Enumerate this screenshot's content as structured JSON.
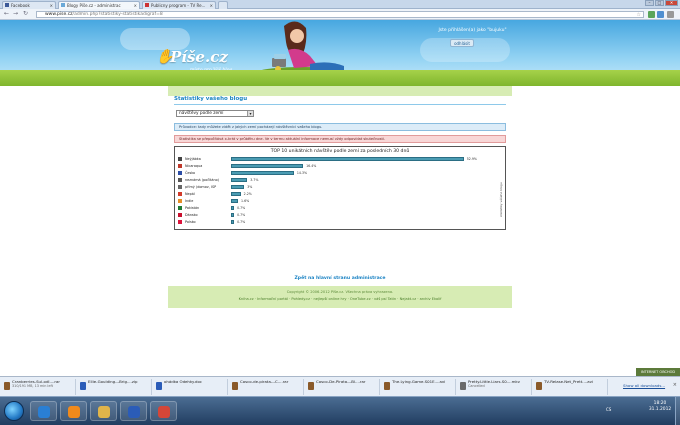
{
  "browser": {
    "tabs": [
      {
        "label": "Facebook",
        "active": false
      },
      {
        "label": "Blogy Píše.cz - administrac",
        "active": true
      },
      {
        "label": "Publicny program - TV Re...",
        "active": false
      }
    ],
    "url": {
      "host": "www.pise.cz",
      "path": "/admin.php?statistiky-statistikadigraf=8"
    },
    "window_controls": {
      "minimize": "–",
      "maximize": "□",
      "close": "✕"
    }
  },
  "header": {
    "logo_text": "Píše.cz",
    "tagline": "místo pro Váš blog",
    "login_text": "Jste přihlášen(a) jako \"bujuku\"",
    "logout_label": "odhlásit"
  },
  "content": {
    "section_title": "Statistiky vašeho blogu",
    "select_value": "návštěvy podle zemí",
    "info_text": "Průvodce: tady můžete vidět z jakých zemí pocházejí návštěvníci vašeho blogu.",
    "warn_text": "Statistika se přepočítává x-krát v průběhu dne. Ve v termu aktuální informace nemusí vždy odpovídat skutečnosti.",
    "chart_side_label": "statistiky vášeho blogu",
    "back_link": "Zpět na hlavní stranu administrace"
  },
  "chart_data": {
    "type": "bar",
    "title": "TOP 10 unikátních návštěv podle zemí za posledních 30 dnů",
    "categories": [
      "Neýjábka",
      "Nicaraqua",
      "Česko",
      "neznámá (počítáno)",
      "přímý (domov, ISP",
      "Nepál",
      "Indie",
      "Pakistán",
      "Dánsko",
      "Polsko"
    ],
    "values": [
      52.9,
      16.4,
      14.3,
      3.7,
      3.0,
      2.2,
      1.6,
      0.7,
      0.7,
      0.7
    ],
    "value_labels": [
      "52.9%",
      "16.4%",
      "14.3%",
      "3.7%",
      "3%",
      "2.2%",
      "1.6%",
      "0.7%",
      "0.7%",
      "0.7%"
    ],
    "flag_colors": [
      "#444444",
      "#c0392b",
      "#2c4da6",
      "#555555",
      "#666666",
      "#d23b2b",
      "#e58e26",
      "#1e7a33",
      "#c8102e",
      "#dc143c"
    ],
    "xlim": [
      0,
      100
    ],
    "orientation": "horizontal"
  },
  "footer": {
    "copyright": "Copyright © 2006-2012 Píše.cz. Všechna práva vyhrazena.",
    "links": "Kniha.cz · Informační portál · Pohledy.cz · nejlepší online hry · OneTube.cz · váš psí Tatin · Nejakt.cz · archiv Ekolif"
  },
  "banner_badge": "INTERNET OBCHOD",
  "downloads": [
    {
      "name": "Cranberries-Sul-odl....rar",
      "sub": "310/191 MB, 13 min left"
    },
    {
      "name": "Ellie-Goulding---Brig....zip",
      "sub": ""
    },
    {
      "name": "ohádka Odehky.doc",
      "sub": ""
    },
    {
      "name": "Cosco-de-pirata---C....rar",
      "sub": ""
    },
    {
      "name": "Cosco-De-Pirata---Bl....rar",
      "sub": ""
    },
    {
      "name": "The.Lying.Game.S01E....avi",
      "sub": ""
    },
    {
      "name": "Pretty.Little.Liars.S0....mkv",
      "sub": "Cancelled"
    },
    {
      "name": "TV-Relase.Net_Prett....avi",
      "sub": ""
    }
  ],
  "downloads_show_all": "Show all downloads...",
  "taskbar": {
    "tray_text": "CS",
    "time": "18:20",
    "date": "31.1.2012",
    "apps": [
      {
        "name": "internet-explorer",
        "color": "#2a7fd4"
      },
      {
        "name": "windows-media-player",
        "color": "#f08a1c"
      },
      {
        "name": "file-explorer",
        "color": "#e0b44a"
      },
      {
        "name": "word",
        "color": "#2b5cb8"
      },
      {
        "name": "chrome",
        "color": "#d44638"
      }
    ]
  }
}
